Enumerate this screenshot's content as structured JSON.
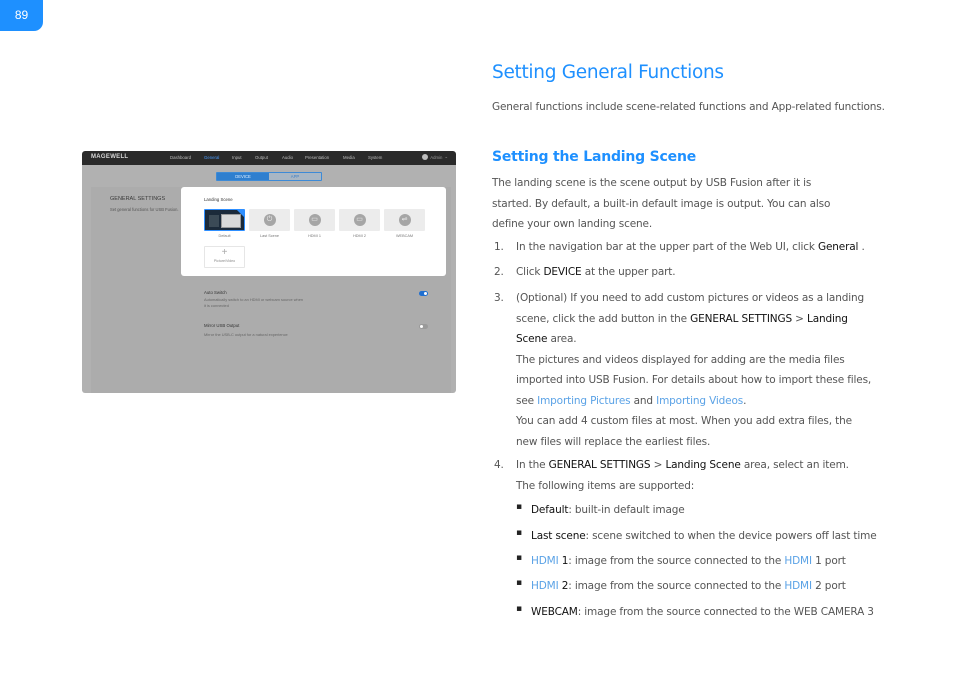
{
  "page_number": "89",
  "title": "Setting General Functions",
  "intro": "General functions include scene-related functions and App-related functions.",
  "section": {
    "heading": "Setting the Landing Scene",
    "paragraph": "The landing scene is the scene output by USB Fusion after it is started. By default, a built-in default image is output. You can also define your own landing scene.",
    "steps": [
      {
        "num": "1.",
        "pre": "In the navigation bar at the upper part of the Web UI, click ",
        "key": "General",
        "post": " ."
      },
      {
        "num": "2.",
        "pre": "Click ",
        "key": "DEVICE",
        "post": " at the upper part."
      },
      {
        "num": "3.",
        "pre": "(Optional) If you need to add custom pictures or videos as a landing scene, click the add button in the ",
        "key1": "GENERAL SETTINGS",
        "sep": " > ",
        "key2": "Landing Scene",
        "post": " area.",
        "note1_pre": "The pictures and videos displayed for adding are the media files imported into USB Fusion. For details about how to import these files, see ",
        "link1": "Importing Pictures",
        "and": " and ",
        "link2": "Importing Videos",
        "note1_post": ".",
        "note2": "You can add 4 custom files at most. When you add extra files, the new files will replace the earliest files."
      },
      {
        "num": "4.",
        "pre": "In the ",
        "key1": "GENERAL SETTINGS",
        "sep": " > ",
        "key2": "Landing Scene",
        "post": " area, select an item.",
        "note": "The following items are supported:"
      }
    ],
    "bullets": [
      {
        "term": "Default",
        "desc": ": built-in default image"
      },
      {
        "term": "Last scene",
        "desc": ": scene switched to when the device powers off last time"
      },
      {
        "term_link": "HDMI",
        "term": " 1",
        "desc_pre": ": image from the source connected to the ",
        "desc_link": "HDMI",
        "desc_post": " 1 port"
      },
      {
        "term_link": "HDMI",
        "term": " 2",
        "desc_pre": ": image from the source connected to the ",
        "desc_link": "HDMI",
        "desc_post": " 2 port"
      },
      {
        "term": "WEBCAM",
        "desc": ": image from the source connected to the WEB CAMERA 3"
      }
    ]
  },
  "screenshot": {
    "logo": "MAGEWELL",
    "nav": [
      "Dashboard",
      "General",
      "Input",
      "Output",
      "Audio",
      "Presentation",
      "Media",
      "System"
    ],
    "nav_active": "General",
    "user": "Admin",
    "segments": {
      "device": "DEVICE",
      "app": "APP"
    },
    "sidebar_title": "GENERAL SETTINGS",
    "sidebar_desc": "Set general functions for USB Fusion.",
    "landing_title": "Landing Scene",
    "tiles": [
      "Default",
      "Last Scene",
      "HDMI 1",
      "HDMI 2",
      "WEBCAM"
    ],
    "add_label": "Picture/Video",
    "auto_switch": {
      "title": "Auto Switch",
      "desc": "Automatically switch to an HDMI or webcam source when it is connected",
      "enabled": true
    },
    "mirror": {
      "title": "Mirror USB Output",
      "desc": "Mirror the USB-C output for a natural experience",
      "enabled": false
    }
  }
}
